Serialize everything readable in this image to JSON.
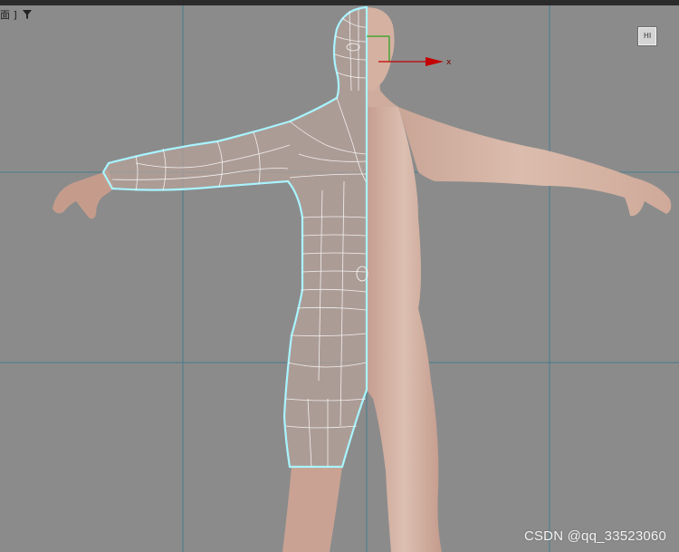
{
  "viewport": {
    "label": "面 ]",
    "filter_icon": "funnel-icon",
    "viewcube_label": "HI"
  },
  "gizmo": {
    "axis_label": "x",
    "x_axis_color": "#c40000",
    "y_axis_color": "#00a000"
  },
  "colors": {
    "background": "#8b8b8b",
    "grid_line": "#3f7f8f",
    "skin": "#d9b8a8",
    "wire_outline": "#a8f4ff",
    "wire_edges": "#ffffff"
  },
  "watermark": "CSDN @qq_33523060"
}
